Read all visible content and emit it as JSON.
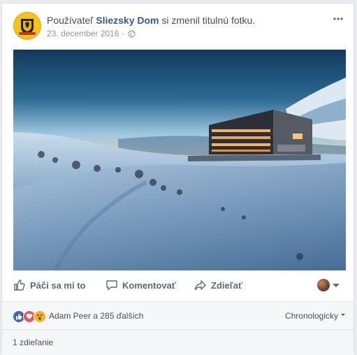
{
  "post": {
    "prefix": "Používateľ",
    "page_name": "Sliezsky Dom",
    "action_text": "si zmenil titulnú fotku.",
    "date": "23. december 2016",
    "separator": "·",
    "privacy_icon": "globe-icon",
    "more_icon": "more-options-icon"
  },
  "actions": {
    "like": "Páči sa mi to",
    "comment": "Komentovať",
    "share": "Zdieľať"
  },
  "reactions": {
    "icons": [
      "like-icon",
      "love-icon",
      "wow-icon"
    ],
    "summary": "Adam Peer a 285 ďalších",
    "sort_label": "Chronologicky"
  },
  "shares": {
    "label": "1 zdieľanie"
  },
  "colors": {
    "link": "#365899",
    "like": "#4267b2",
    "love": "#f25268",
    "wow": "#f7b125"
  }
}
